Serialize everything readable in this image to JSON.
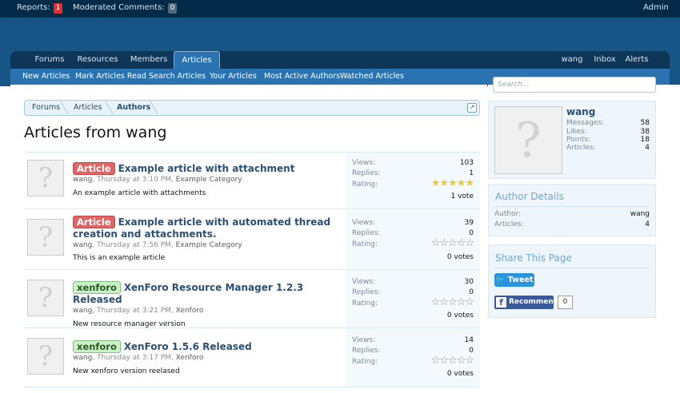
{
  "topbar": {
    "reports_label": "Reports:",
    "reports_count": "1",
    "moderated_label": "Moderated Comments:",
    "moderated_count": "0",
    "admin_label": "Admin"
  },
  "nav": {
    "tabs": [
      "Forums",
      "Resources",
      "Members",
      "Articles"
    ],
    "selected_tab": "Articles",
    "right_links": [
      "wang",
      "Inbox",
      "Alerts"
    ]
  },
  "subnav": [
    "New Articles",
    "Mark Articles Read",
    "Search Articles",
    "Your Articles",
    "Most Active Authors",
    "Watched Articles"
  ],
  "search": {
    "placeholder": "Search..."
  },
  "breadcrumb": [
    "Forums",
    "Articles",
    "Authors"
  ],
  "page_title": "Articles from wang",
  "articles": [
    {
      "prefix": "Article",
      "prefix_color": "red",
      "title": "Example article with attachment",
      "author": "wang",
      "date": "Thursday at 3:10 PM",
      "category": "Example Category",
      "description": "An example article with attachments",
      "views": "103",
      "replies": "1",
      "rating": 5,
      "votes": "1 vote"
    },
    {
      "prefix": "Article",
      "prefix_color": "red",
      "title": "Example article with automated thread creation and attachments.",
      "author": "wang",
      "date": "Thursday at 7:56 PM",
      "category": "Example Category",
      "description": "This is an example article",
      "views": "39",
      "replies": "0",
      "rating": 0,
      "votes": "0 votes"
    },
    {
      "prefix": "xenforo",
      "prefix_color": "green",
      "title": "XenForo Resource Manager 1.2.3 Released",
      "author": "wang",
      "date": "Thursday at 3:21 PM",
      "category": "Xenforo",
      "description": "New resource manager version",
      "views": "30",
      "replies": "0",
      "rating": 0,
      "votes": "0 votes"
    },
    {
      "prefix": "xenforo",
      "prefix_color": "green",
      "title": "XenForo 1.5.6 Released",
      "author": "wang",
      "date": "Thursday at 3:17 PM",
      "category": "Xenforo",
      "description": "New xenforo version reelased",
      "views": "14",
      "replies": "0",
      "rating": 0,
      "votes": "0 votes"
    }
  ],
  "stat_labels": {
    "views": "Views:",
    "replies": "Replies:",
    "rating": "Rating:"
  },
  "sidebar": {
    "profile": {
      "name": "wang",
      "stats": [
        {
          "label": "Messages:",
          "value": "58"
        },
        {
          "label": "Likes:",
          "value": "38"
        },
        {
          "label": "Points:",
          "value": "18"
        },
        {
          "label": "Articles:",
          "value": "4"
        }
      ]
    },
    "author_details": {
      "heading": "Author Details",
      "author_label": "Author:",
      "author_value": "wang",
      "articles_label": "Articles:",
      "articles_value": "4"
    },
    "share": {
      "heading": "Share This Page",
      "tweet_label": "Tweet",
      "recommend_label": "Recommend",
      "recommend_count": "0"
    }
  },
  "colors": {
    "topbar": "#032a46",
    "header": "#175586",
    "navbar": "#0e3659",
    "accent": "#2b73b0",
    "badge_red": "#e03030",
    "link": "#2b5074"
  },
  "icons": [
    "question-avatar-icon",
    "star-icon",
    "twitter-bird-icon",
    "facebook-icon",
    "jump-to-icon"
  ]
}
